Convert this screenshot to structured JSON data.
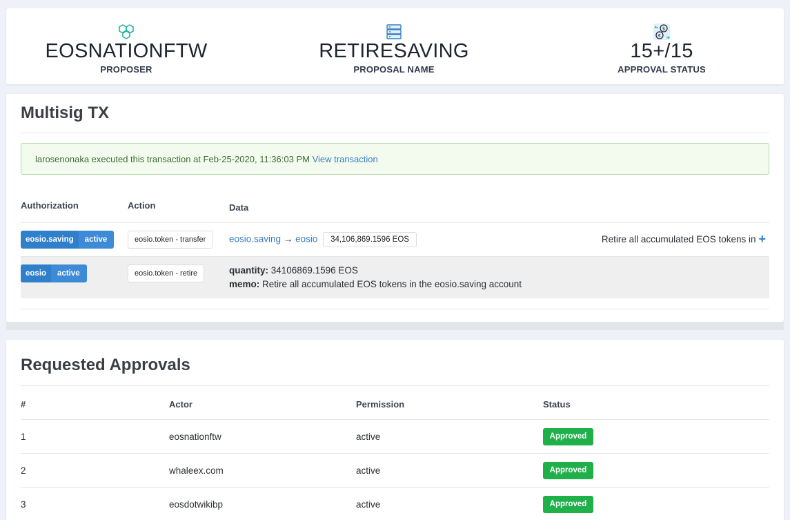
{
  "summary": {
    "proposer": {
      "value": "EOSNATIONFTW",
      "label": "PROPOSER",
      "icon": "cubes-icon"
    },
    "proposal": {
      "value": "RETIRESAVING",
      "label": "PROPOSAL NAME",
      "icon": "server-icon"
    },
    "approval": {
      "value": "15+/15",
      "label": "APPROVAL STATUS",
      "icon": "currency-exchange-icon"
    }
  },
  "multisig": {
    "title": "Multisig TX",
    "notice": {
      "text": "larosenonaka executed this transaction at Feb-25-2020, 11:36:03 PM",
      "link": "View transaction"
    },
    "headers": {
      "authorization": "Authorization",
      "action": "Action",
      "data": "Data"
    },
    "rows": [
      {
        "actor": "eosio.saving",
        "permission": "active",
        "action": "eosio.token - transfer",
        "from": "eosio.saving",
        "arrow": "→",
        "to": "eosio",
        "amount": "34,106,869.1596 EOS",
        "note": "Retire all accumulated EOS tokens in"
      },
      {
        "actor": "eosio",
        "permission": "active",
        "action": "eosio.token - retire",
        "quantity_label": "quantity:",
        "quantity": "34106869.1596 EOS",
        "memo_label": "memo:",
        "memo": "Retire all accumulated EOS tokens in the eosio.saving account"
      }
    ]
  },
  "approvals": {
    "title": "Requested Approvals",
    "headers": {
      "num": "#",
      "actor": "Actor",
      "permission": "Permission",
      "status": "Status"
    },
    "rows": [
      {
        "num": "1",
        "actor": "eosnationftw",
        "permission": "active",
        "status": "Approved"
      },
      {
        "num": "2",
        "actor": "whaleex.com",
        "permission": "active",
        "status": "Approved"
      },
      {
        "num": "3",
        "actor": "eosdotwikibp",
        "permission": "active",
        "status": "Approved"
      }
    ]
  },
  "colors": {
    "primary": "#2f7fcb",
    "success": "#1fb04a",
    "link": "#3a7ebf",
    "icon": "#1fb4a0"
  }
}
